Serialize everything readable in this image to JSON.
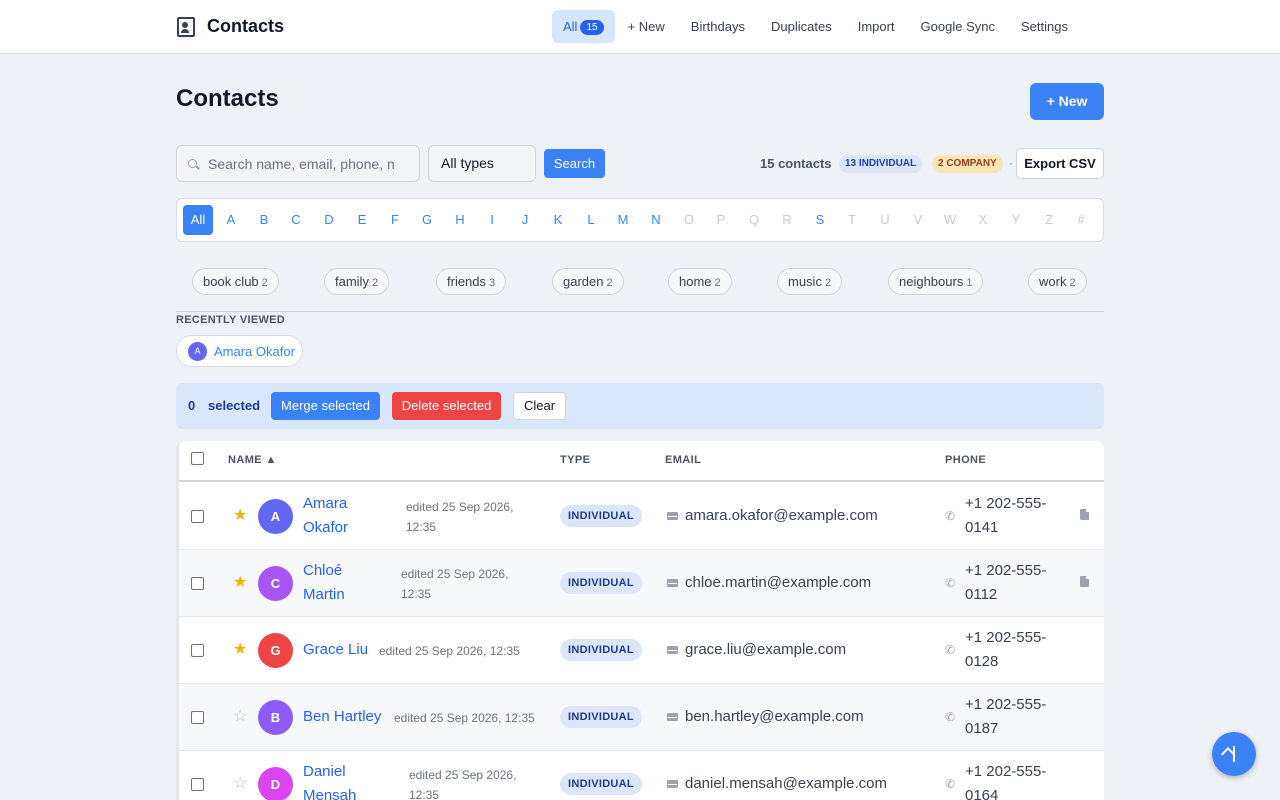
{
  "app": {
    "title": "Contacts"
  },
  "nav": {
    "all_label": "All",
    "all_count": "15",
    "new_label": "+ New",
    "birthdays_label": "Birthdays",
    "duplicates_label": "Duplicates",
    "import_label": "Import",
    "google_sync_label": "Google Sync",
    "settings_label": "Settings"
  },
  "page": {
    "title": "Contacts",
    "new_button": "+ New"
  },
  "search": {
    "placeholder": "Search name, email, phone, n",
    "value": "",
    "type_filter": "All types",
    "button": "Search"
  },
  "summary": {
    "count_text": "15 contacts",
    "individual_badge": "13 INDIVIDUAL",
    "company_badge": "2 COMPANY",
    "separator": "·",
    "export_button": "Export CSV"
  },
  "alphabet": [
    {
      "label": "All",
      "state": "active"
    },
    {
      "label": "A",
      "state": "on"
    },
    {
      "label": "B",
      "state": "on"
    },
    {
      "label": "C",
      "state": "on"
    },
    {
      "label": "D",
      "state": "on"
    },
    {
      "label": "E",
      "state": "on"
    },
    {
      "label": "F",
      "state": "on"
    },
    {
      "label": "G",
      "state": "on"
    },
    {
      "label": "H",
      "state": "on"
    },
    {
      "label": "I",
      "state": "on"
    },
    {
      "label": "J",
      "state": "on"
    },
    {
      "label": "K",
      "state": "on"
    },
    {
      "label": "L",
      "state": "on"
    },
    {
      "label": "M",
      "state": "on"
    },
    {
      "label": "N",
      "state": "on"
    },
    {
      "label": "O",
      "state": "dim"
    },
    {
      "label": "P",
      "state": "dim"
    },
    {
      "label": "Q",
      "state": "dim"
    },
    {
      "label": "R",
      "state": "dim"
    },
    {
      "label": "S",
      "state": "on"
    },
    {
      "label": "T",
      "state": "dim"
    },
    {
      "label": "U",
      "state": "dim"
    },
    {
      "label": "V",
      "state": "dim"
    },
    {
      "label": "W",
      "state": "dim"
    },
    {
      "label": "X",
      "state": "dim"
    },
    {
      "label": "Y",
      "state": "dim"
    },
    {
      "label": "Z",
      "state": "dim"
    },
    {
      "label": "#",
      "state": "dim"
    }
  ],
  "tags": [
    {
      "name": "book club",
      "count": "2"
    },
    {
      "name": "family",
      "count": "2"
    },
    {
      "name": "friends",
      "count": "3"
    },
    {
      "name": "garden",
      "count": "2"
    },
    {
      "name": "home",
      "count": "2"
    },
    {
      "name": "music",
      "count": "2"
    },
    {
      "name": "neighbours",
      "count": "1"
    },
    {
      "name": "work",
      "count": "2"
    }
  ],
  "recent": {
    "label": "RECENTLY VIEWED",
    "items": [
      {
        "initial": "A",
        "name": "Amara Okafor"
      }
    ]
  },
  "bulk": {
    "count": "0",
    "label": "selected",
    "merge_button": "Merge selected",
    "delete_button": "Delete selected",
    "clear_button": "Clear"
  },
  "table": {
    "headers": {
      "name": "NAME ▲",
      "type": "TYPE",
      "email": "EMAIL",
      "phone": "PHONE"
    },
    "rows": [
      {
        "starred": true,
        "initial": "A",
        "name_l1": "Amara",
        "name_l2": "Okafor",
        "edited_l1": "edited 25 Sep 2026,",
        "edited_l2": "12:35",
        "type": "INDIVIDUAL",
        "email": "amara.okafor@example.com",
        "phone_l1": "+1 202-555-",
        "phone_l2": "0141",
        "has_note": true
      },
      {
        "starred": true,
        "initial": "C",
        "name_l1": "Chloé",
        "name_l2": "Martin",
        "edited_l1": "edited 25 Sep 2026,",
        "edited_l2": "12:35",
        "type": "INDIVIDUAL",
        "email": "chloe.martin@example.com",
        "phone_l1": "+1 202-555-",
        "phone_l2": "0112",
        "has_note": true
      },
      {
        "starred": true,
        "initial": "G",
        "name_l1": "Grace Liu",
        "name_l2": "",
        "edited_l1": "edited 25 Sep 2026, 12:35",
        "edited_l2": "",
        "type": "INDIVIDUAL",
        "email": "grace.liu@example.com",
        "phone_l1": "+1 202-555-",
        "phone_l2": "0128",
        "has_note": false
      },
      {
        "starred": false,
        "initial": "B",
        "name_l1": "Ben Hartley",
        "name_l2": "",
        "edited_l1": "edited 25 Sep 2026, 12:35",
        "edited_l2": "",
        "type": "INDIVIDUAL",
        "email": "ben.hartley@example.com",
        "phone_l1": "+1 202-555-",
        "phone_l2": "0187",
        "has_note": false
      },
      {
        "starred": false,
        "initial": "D",
        "name_l1": "Daniel",
        "name_l2": "Mensah",
        "edited_l1": "edited 25 Sep 2026,",
        "edited_l2": "12:35",
        "type": "INDIVIDUAL",
        "email": "daniel.mensah@example.com",
        "phone_l1": "+1 202-555-",
        "phone_l2": "0164",
        "has_note": false
      }
    ]
  },
  "colors": {
    "accent": "#3b82f6",
    "danger": "#ef4444",
    "star": "#eab308",
    "avatar_a": "#6366f1",
    "avatar_c": "#a855f7",
    "avatar_g": "#ef4444",
    "avatar_b": "#8b5cf6",
    "avatar_d": "#d946ef"
  },
  "icons": {
    "brand": "address-book-icon",
    "search": "search-icon",
    "email": "mail-icon",
    "phone": "phone-icon",
    "note": "document-icon",
    "scroll_top": "arrow-up-icon"
  }
}
